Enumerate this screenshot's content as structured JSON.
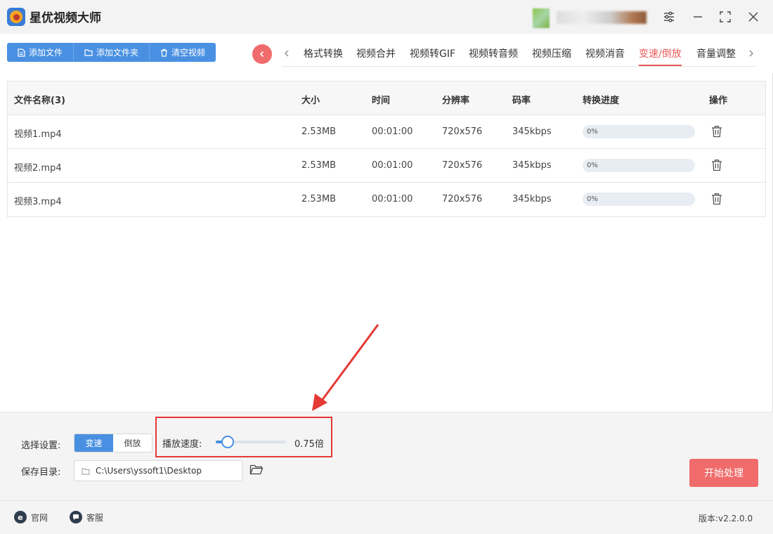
{
  "app": {
    "title": "星优视频大师"
  },
  "toolbar": {
    "add_file": "添加文件",
    "add_folder": "添加文件夹",
    "clear_videos": "清空视频"
  },
  "tabs": [
    {
      "label": "格式转换"
    },
    {
      "label": "视频合并"
    },
    {
      "label": "视频转GIF"
    },
    {
      "label": "视频转音频"
    },
    {
      "label": "视频压缩"
    },
    {
      "label": "视频消音"
    },
    {
      "label": "变速/倒放",
      "active": true
    },
    {
      "label": "音量调整"
    }
  ],
  "table": {
    "headers": {
      "name": "文件名称(3)",
      "size": "大小",
      "duration": "时间",
      "resolution": "分辨率",
      "bitrate": "码率",
      "progress": "转换进度",
      "actions": "操作"
    },
    "rows": [
      {
        "name": "视频1.mp4",
        "size": "2.53MB",
        "duration": "00:01:00",
        "resolution": "720x576",
        "bitrate": "345kbps",
        "progress": "0%"
      },
      {
        "name": "视频2.mp4",
        "size": "2.53MB",
        "duration": "00:01:00",
        "resolution": "720x576",
        "bitrate": "345kbps",
        "progress": "0%"
      },
      {
        "name": "视频3.mp4",
        "size": "2.53MB",
        "duration": "00:01:00",
        "resolution": "720x576",
        "bitrate": "345kbps",
        "progress": "0%"
      }
    ]
  },
  "settings": {
    "mode_label": "选择设置:",
    "mode_options": [
      "变速",
      "倒放"
    ],
    "mode_selected": "变速",
    "speed_label": "播放速度:",
    "speed_value": "0.75倍",
    "speed_level": 0.17,
    "save_dir_label": "保存目录:",
    "save_dir_value": "C:\\Users\\yssoft1\\Desktop",
    "start_button": "开始处理"
  },
  "footer": {
    "website": "官网",
    "support": "客服",
    "version": "版本:v2.2.0.0"
  },
  "colors": {
    "primary": "#4a90e2",
    "accent": "#f06b6b",
    "active_tab": "#e95a5a",
    "annotation": "#e53935"
  }
}
